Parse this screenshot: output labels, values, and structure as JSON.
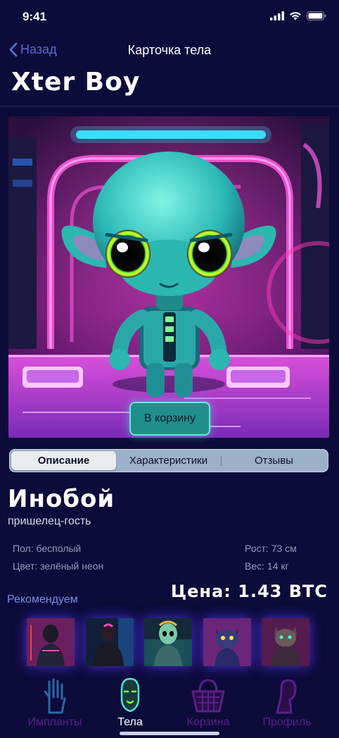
{
  "status": {
    "time": "9:41"
  },
  "nav": {
    "back_label": "Назад",
    "title": "Карточка тела"
  },
  "product": {
    "name": "Xter Boy",
    "add_to_cart_label": "В корзину",
    "type_title": "Инобой",
    "type_subtitle": "пришелец-гость",
    "gender": "Пол: бесполый",
    "color": "Цвет: зелёный неон",
    "height": "Рост: 73 см",
    "weight": "Вес: 14 кг",
    "price": "Цена: 1.43 BTC"
  },
  "tabs": [
    {
      "label": "Описание",
      "active": true
    },
    {
      "label": "Характеристики",
      "active": false
    },
    {
      "label": "Отзывы",
      "active": false
    }
  ],
  "recommend": {
    "title": "Рекомендуем",
    "items": [
      {
        "icon": "cyber-woman-thumbnail"
      },
      {
        "icon": "cyber-man-thumbnail"
      },
      {
        "icon": "alien-woman-thumbnail"
      },
      {
        "icon": "cyber-dog-thumbnail"
      },
      {
        "icon": "cyber-cat-thumbnail"
      }
    ]
  },
  "tabbar": {
    "items": [
      {
        "label": "Импланты",
        "icon": "hand-implant-icon",
        "active": false
      },
      {
        "label": "Тела",
        "icon": "head-body-icon",
        "active": true
      },
      {
        "label": "Корзина",
        "icon": "basket-icon",
        "active": false
      },
      {
        "label": "Профиль",
        "icon": "profile-icon",
        "active": false
      }
    ]
  },
  "colors": {
    "background": "#0d0b3a",
    "accent": "#5a6bd8",
    "active_tab": "#4fe3d0",
    "inactive_tab": "#5a1f8a"
  }
}
